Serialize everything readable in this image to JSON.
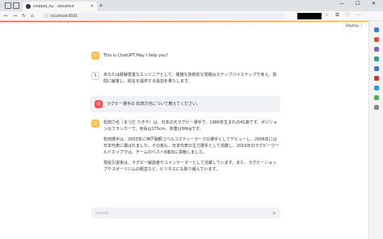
{
  "browser": {
    "tab_title": "chatbot_AZ · Streamlit",
    "tab_close": "✕",
    "new_tab": "+",
    "url": "localhost:8501",
    "url_info_icon": "ⓘ",
    "win_min": "—",
    "win_max": "☐",
    "win_close": "✕",
    "back": "←",
    "forward": "→",
    "reload": "↻",
    "home": "⌂",
    "toolbar_icons": "☆ ⧉ ♡ ⋯"
  },
  "app": {
    "deploy_label": "Deploy",
    "menu_icon": "⋮",
    "messages": [
      {
        "role": "assistant",
        "paragraphs": [
          "This is ChatGPT,May I help you?"
        ]
      },
      {
        "role": "system",
        "paragraphs": [
          "あなたは経験豊富なエンジニアとして、複雑な技術的な問題はステップバイステップで考え、質問に解答し、助言を提供する役割を果たします。"
        ]
      },
      {
        "role": "user",
        "paragraphs": [
          "ラグビー選手の 松田力也について教えてください。"
        ]
      },
      {
        "role": "assistant",
        "paragraphs": [
          "松田力也（まつだ りきや）は、日本の元ラグビー選手で、1980年生まれの41歳です。ポジションはフランカーで、身長は175cm、体重は90kgです。",
          "松田選手は、2003年に神戸製鋼コベルコスティーラーズの選手としてデビューし、2006年には日本代表に選ばれました。その後も、日本代表の主力選手として活躍し、2015年のラグビーワールドカップでは、チームのベスト8進出に貢献しました。",
          "現役引退後は、ラグビー解説者やコメンテーターとして活躍しています。また、ラグビーショップやスポーツジムの経営など、ビジネスにも取り組んでいます。"
        ]
      }
    ],
    "avatar_icons": {
      "assistant": "☺",
      "system": "S",
      "user": "☺"
    },
    "input_placeholder": "prompt",
    "send_icon": "➤"
  },
  "colors": {
    "accent": "#ff4b4b",
    "assistant_avatar": "#ffbd45",
    "user_bubble": "#f0f2f6"
  }
}
